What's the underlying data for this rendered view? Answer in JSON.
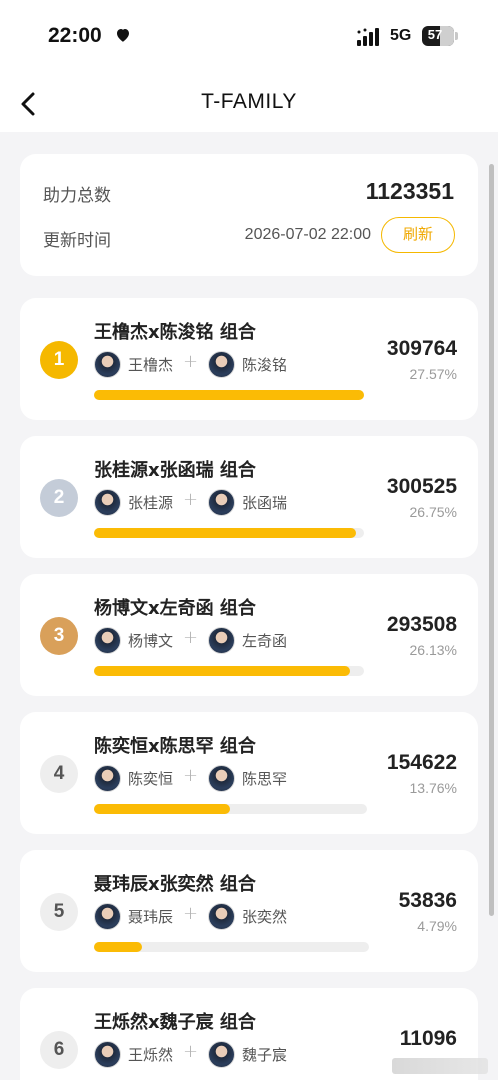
{
  "status_bar": {
    "time": "22:00",
    "network": "5G",
    "battery": "57",
    "battery_level": 0.57
  },
  "nav": {
    "title": "T-FAMILY"
  },
  "summary": {
    "total_label": "助力总数",
    "total_value": "1123351",
    "updated_label": "更新时间",
    "updated_value": "2026-07-02 22:00",
    "refresh_label": "刷新"
  },
  "ranking": [
    {
      "rank": "1",
      "badge_color": "#f5b800",
      "badge_text_color": "#ffffff",
      "group": "王橹杰x陈浚铭 组合",
      "member1": "王橹杰",
      "member2": "陈浚铭",
      "score": "309764",
      "percent": "27.57%",
      "progress": 1.0
    },
    {
      "rank": "2",
      "badge_color": "#c4ccd8",
      "badge_text_color": "#ffffff",
      "group": "张桂源x张函瑞 组合",
      "member1": "张桂源",
      "member2": "张函瑞",
      "score": "300525",
      "percent": "26.75%",
      "progress": 0.97
    },
    {
      "rank": "3",
      "badge_color": "#d9a05a",
      "badge_text_color": "#ffffff",
      "group": "杨博文x左奇函 组合",
      "member1": "杨博文",
      "member2": "左奇函",
      "score": "293508",
      "percent": "26.13%",
      "progress": 0.948
    },
    {
      "rank": "4",
      "badge_color": "#eeeeee",
      "badge_text_color": "#555555",
      "group": "陈奕恒x陈思罕 组合",
      "member1": "陈奕恒",
      "member2": "陈思罕",
      "score": "154622",
      "percent": "13.76%",
      "progress": 0.499
    },
    {
      "rank": "5",
      "badge_color": "#eeeeee",
      "badge_text_color": "#555555",
      "group": "聂玮辰x张奕然 组合",
      "member1": "聂玮辰",
      "member2": "张奕然",
      "score": "53836",
      "percent": "4.79%",
      "progress": 0.174
    },
    {
      "rank": "6",
      "badge_color": "#eeeeee",
      "badge_text_color": "#555555",
      "group": "王烁然x魏子宸 组合",
      "member1": "王烁然",
      "member2": "魏子宸",
      "score": "11096",
      "percent": "",
      "progress": 0.036
    }
  ]
}
